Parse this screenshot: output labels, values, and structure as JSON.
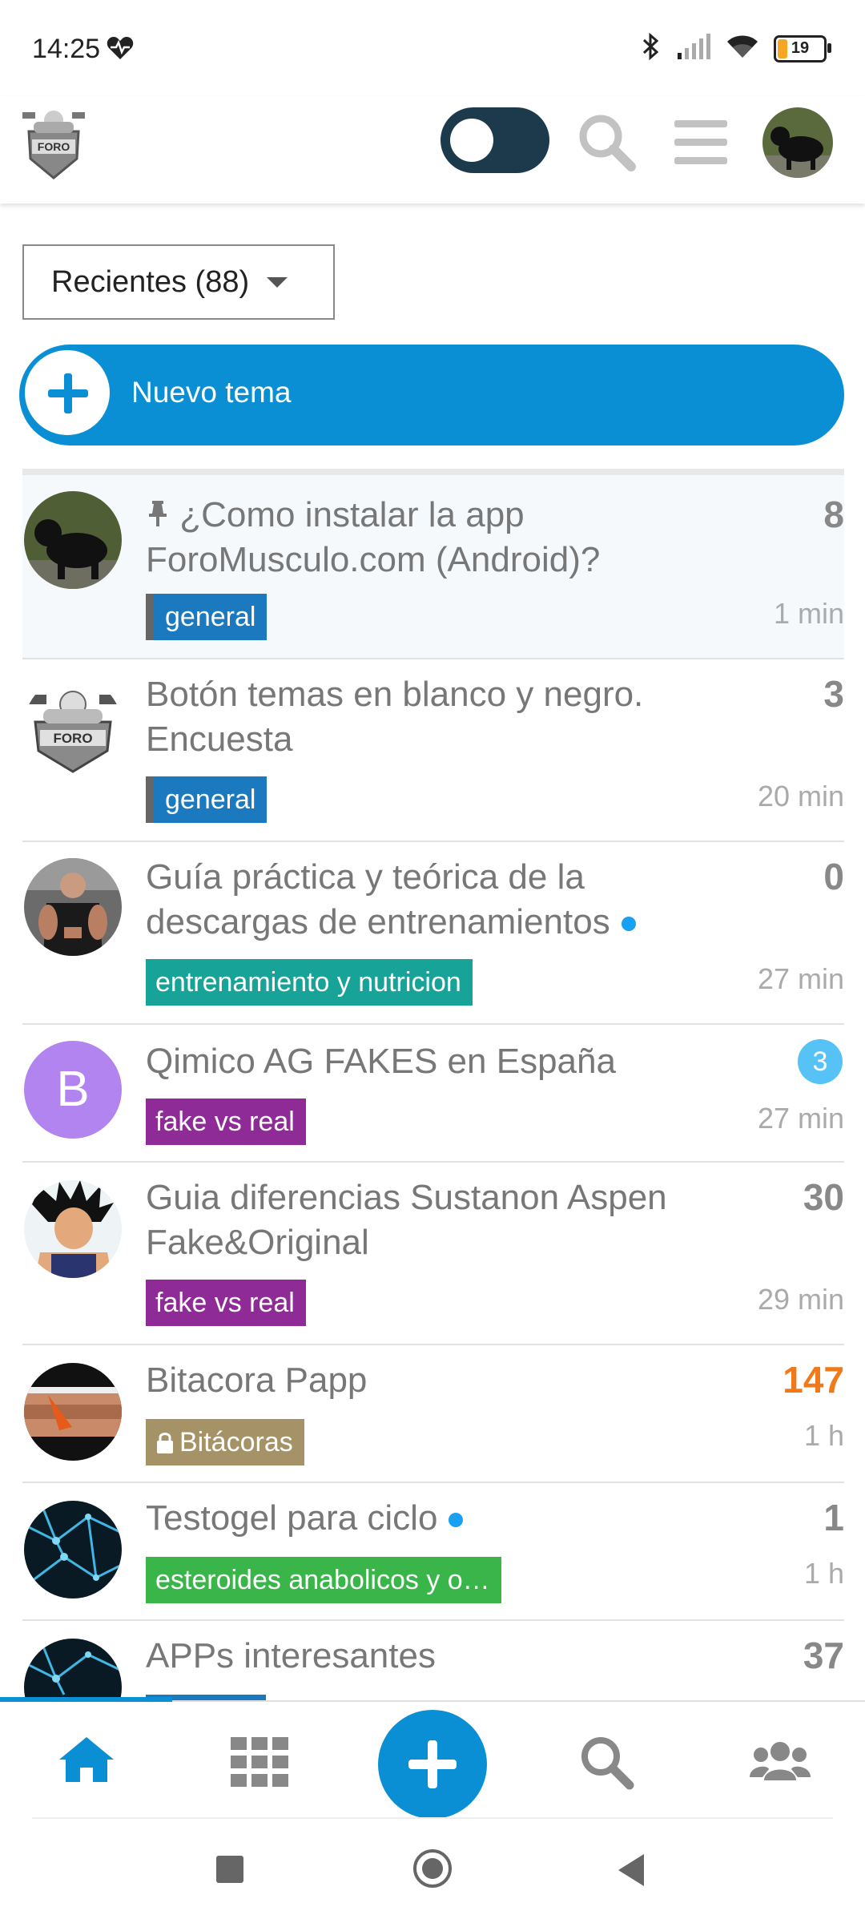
{
  "status_bar": {
    "time": "14:25",
    "battery": "19",
    "icons": [
      "heart-pulse-icon",
      "bluetooth-icon",
      "signal-icon",
      "wifi-icon",
      "battery-icon"
    ]
  },
  "header": {
    "logo_icon": "foro-musculo-logo",
    "theme_toggle_icon": "theme-toggle",
    "search_icon": "search-icon",
    "menu_icon": "hamburger-menu-icon",
    "avatar_icon": "user-avatar"
  },
  "filter": {
    "label": "Recientes (88)"
  },
  "new_topic": {
    "label": "Nuevo tema"
  },
  "topics": [
    {
      "title": "¿Como instalar la app ForoMusculo.com (Android)?",
      "pinned": true,
      "count": "8",
      "time": "1 min",
      "category": "general",
      "category_color": "#1b7abf"
    },
    {
      "title": "Botón temas en blanco y negro. Encuesta",
      "count": "3",
      "time": "20 min",
      "category": "general",
      "category_color": "#1b7abf"
    },
    {
      "title": "Guía práctica y teórica de la descargas de entrenamientos",
      "unread_dot": true,
      "count": "0",
      "time": "27 min",
      "category": "entrenamiento y nutricion",
      "category_color": "#17a398"
    },
    {
      "title": "Qimico AG FAKES en España",
      "new_badge": "3",
      "time": "27 min",
      "category": "fake vs real",
      "category_color": "#8f2b96",
      "avatar_letter": "B"
    },
    {
      "title": "Guia diferencias Sustanon Aspen Fake&Original",
      "count": "30",
      "time": "29 min",
      "category": "fake vs real",
      "category_color": "#8f2b96"
    },
    {
      "title": "Bitacora Papp",
      "count": "147",
      "time": "1 h",
      "category": "Bitácoras",
      "category_color": "#a69267",
      "locked": true
    },
    {
      "title": "Testogel para ciclo",
      "unread_dot": true,
      "count": "1",
      "time": "1 h",
      "category": "esteroides anabolicos y o…",
      "category_color": "#3ab54a"
    },
    {
      "title": "APPs interesantes",
      "count": "37"
    }
  ],
  "bottom_nav": {
    "items": [
      "home-icon",
      "categories-grid-icon",
      "new-topic-fab",
      "search-icon",
      "users-icon"
    ]
  }
}
